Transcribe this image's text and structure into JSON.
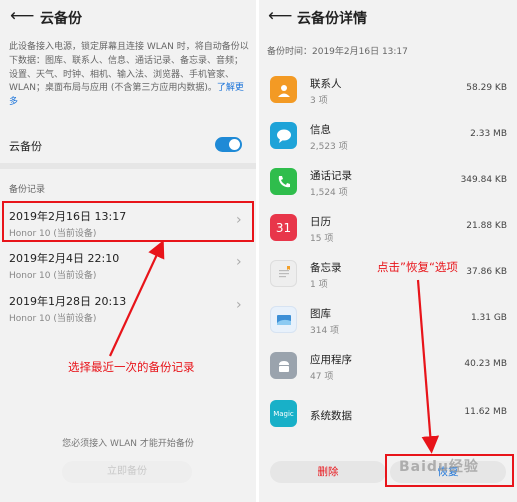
{
  "left": {
    "title": "云备份",
    "back_icon": "back-arrow-icon",
    "description": "此设备接入电源，锁定屏幕且连接 WLAN 时，将自动备份以下数据：图库、联系人、信息、通话记录、备忘录、音频；设置、天气、时钟、相机、输入法、浏览器、手机管家、WLAN；桌面布局与应用 (不含第三方应用内数据)。",
    "learn_more": "了解更多",
    "toggle_label": "云备份",
    "toggle_on": true,
    "section_title": "备份记录",
    "records": [
      {
        "date": "2019年2月16日 13:17",
        "device": "Honor 10 (当前设备)"
      },
      {
        "date": "2019年2月4日 22:10",
        "device": "Honor 10 (当前设备)"
      },
      {
        "date": "2019年1月28日 20:13",
        "device": "Honor 10 (当前设备)"
      }
    ],
    "annotation": "选择最近一次的备份记录",
    "hint": "您必须接入 WLAN 才能开始备份",
    "start_button": "立即备份"
  },
  "right": {
    "title": "云备份详情",
    "back_icon": "back-arrow-icon",
    "backup_time": "备份时间：2019年2月16日 13:17",
    "items": [
      {
        "name": "联系人",
        "count": "3 项",
        "size": "58.29 KB",
        "icon": "contacts-icon",
        "color": "#f39a24",
        "glyph": "👤"
      },
      {
        "name": "信息",
        "count": "2,523 项",
        "size": "2.33 MB",
        "icon": "messages-icon",
        "color": "#1ea3d8",
        "glyph": "💬"
      },
      {
        "name": "通话记录",
        "count": "1,524 项",
        "size": "349.84 KB",
        "icon": "phone-icon",
        "color": "#2fbd4c",
        "glyph": "☎"
      },
      {
        "name": "日历",
        "count": "15 项",
        "size": "21.88 KB",
        "icon": "calendar-icon",
        "color": "#e8364a",
        "glyph": "31"
      },
      {
        "name": "备忘录",
        "count": "1 项",
        "size": "37.86 KB",
        "icon": "notepad-icon",
        "color": "#eeeeee",
        "glyph": ""
      },
      {
        "name": "图库",
        "count": "314 项",
        "size": "1.31 GB",
        "icon": "gallery-icon",
        "color": "#3d8fd6",
        "glyph": "▤"
      },
      {
        "name": "应用程序",
        "count": "47 项",
        "size": "40.23 MB",
        "icon": "android-icon",
        "color": "#9aa3ad",
        "glyph": "⚙"
      },
      {
        "name": "系统数据",
        "count": "",
        "size": "11.62 MB",
        "icon": "magic-icon",
        "color": "#18b0c8",
        "glyph": "Magic"
      }
    ],
    "annotation": "点击”恢复“选项",
    "delete_button": "删除",
    "restore_button": "恢复"
  },
  "colors": {
    "annotation_red": "#e8141a",
    "accent_blue": "#1f8ad6",
    "link_blue": "#1a73d9"
  },
  "watermark": "Baidu经验"
}
